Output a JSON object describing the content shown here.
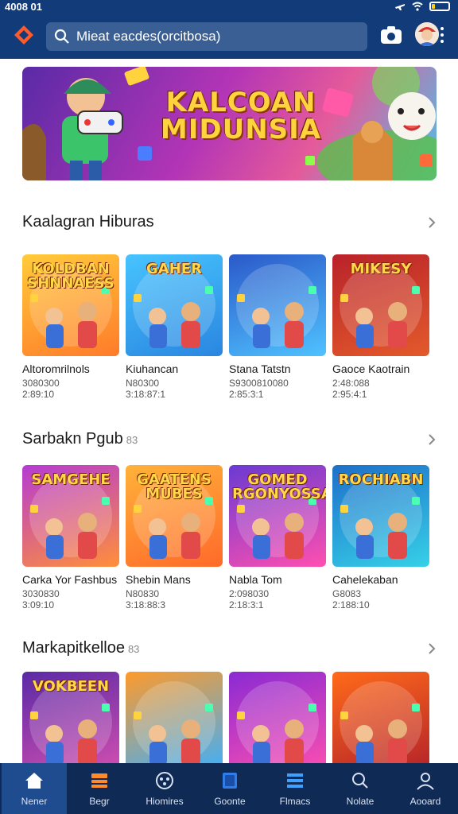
{
  "status": {
    "time": "4008 01",
    "battery_level": 0.2
  },
  "header": {
    "search_text": "Mieat eacdes(orcitbosa)"
  },
  "hero": {
    "title_line1": "KALCOAN",
    "title_line2": "MIDUNSIA"
  },
  "sections": [
    {
      "title": "Kaalagran Hiburas",
      "suffix": "",
      "cards": [
        {
          "thumb_title": "KOLDBAN SHNNAESS",
          "name": "Altoromrilnols",
          "meta1": "3080300",
          "meta2": "2:89:10",
          "colors": [
            "#ffcb3a",
            "#ff7b2a"
          ]
        },
        {
          "thumb_title": "GAHER",
          "name": "Kiuhancan",
          "meta1": "N80300",
          "meta2": "3:18:87:1",
          "colors": [
            "#47c4ff",
            "#2a86e0"
          ]
        },
        {
          "thumb_title": "",
          "name": "Stana Tatstn",
          "meta1": "S9300810080",
          "meta2": "2:85:3:1",
          "colors": [
            "#2b59c9",
            "#4fc2ff"
          ]
        },
        {
          "thumb_title": "MIKESY",
          "name": "Gaoce Kaotrain",
          "meta1": "2:48:088",
          "meta2": "2:95:4:1",
          "colors": [
            "#b9222a",
            "#e35a2b"
          ]
        }
      ]
    },
    {
      "title": "Sarbakn Pgub",
      "suffix": "83",
      "cards": [
        {
          "thumb_title": "SAMGEHE",
          "name": "Carka Yor Fashbus",
          "meta1": "3030830",
          "meta2": "3:09:10",
          "colors": [
            "#b53bd3",
            "#ff8f3a"
          ]
        },
        {
          "thumb_title": "GAATENS MUBES",
          "name": "Shebin Mans",
          "meta1": "N80830",
          "meta2": "3:18:88:3",
          "colors": [
            "#ffb23a",
            "#ff6a2a"
          ]
        },
        {
          "thumb_title": "GOMED RGONYOSSA",
          "name": "Nabla Tom",
          "meta1": "2:098030",
          "meta2": "2:18:3:1",
          "colors": [
            "#6a3ad3",
            "#ff4fb0"
          ]
        },
        {
          "thumb_title": "ROCHIABN",
          "name": "Cahelekaban",
          "meta1": "G8083",
          "meta2": "2:188:10",
          "colors": [
            "#1e6fc9",
            "#36d0e8"
          ]
        }
      ]
    },
    {
      "title": "Markapitkelloe",
      "suffix": "83",
      "cards": [
        {
          "thumb_title": "VOKBEEN",
          "name": "",
          "meta1": "",
          "meta2": "",
          "colors": [
            "#5a2aa6",
            "#d34fb0"
          ]
        },
        {
          "thumb_title": "",
          "name": "",
          "meta1": "",
          "meta2": "",
          "colors": [
            "#ff9a2a",
            "#3ab0ff"
          ]
        },
        {
          "thumb_title": "",
          "name": "",
          "meta1": "",
          "meta2": "",
          "colors": [
            "#8a2ad3",
            "#ff4fb0"
          ]
        },
        {
          "thumb_title": "",
          "name": "",
          "meta1": "",
          "meta2": "",
          "colors": [
            "#ff6a1a",
            "#b3222a"
          ]
        }
      ]
    }
  ],
  "nav": [
    {
      "label": "Nener",
      "icon": "home-icon"
    },
    {
      "label": "Begr",
      "icon": "stack-icon"
    },
    {
      "label": "Hiomires",
      "icon": "controller-icon"
    },
    {
      "label": "Goonte",
      "icon": "book-icon"
    },
    {
      "label": "Flmacs",
      "icon": "list-icon"
    },
    {
      "label": "Nolate",
      "icon": "search-icon"
    },
    {
      "label": "Aooard",
      "icon": "person-icon"
    }
  ],
  "colors": {
    "appbar": "#123b7a",
    "bottom_nav": "#0f2a55",
    "accent": "#ff5a2a"
  }
}
